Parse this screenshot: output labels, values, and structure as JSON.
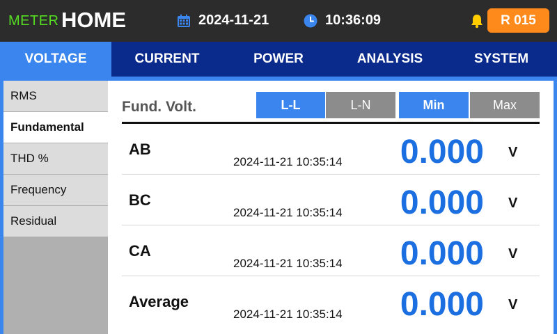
{
  "header": {
    "brand_prefix": "METER",
    "brand_title": "HOME",
    "date": "2024-11-21",
    "time": "10:36:09",
    "record_badge": "R 015"
  },
  "tabs": [
    {
      "label": "VOLTAGE",
      "active": true
    },
    {
      "label": "CURRENT",
      "active": false
    },
    {
      "label": "POWER",
      "active": false
    },
    {
      "label": "ANALYSIS",
      "active": false
    },
    {
      "label": "SYSTEM",
      "active": false
    }
  ],
  "sidebar": {
    "items": [
      {
        "label": "RMS",
        "active": false
      },
      {
        "label": "Fundamental",
        "active": true
      },
      {
        "label": "THD %",
        "active": false
      },
      {
        "label": "Frequency",
        "active": false
      },
      {
        "label": "Residual",
        "active": false
      }
    ]
  },
  "main": {
    "title": "Fund. Volt.",
    "connection_toggle": {
      "ll": "L-L",
      "ln": "L-N",
      "selected": "L-L"
    },
    "range_toggle": {
      "min": "Min",
      "max": "Max",
      "selected": "Min"
    },
    "rows": [
      {
        "label": "AB",
        "timestamp": "2024-11-21 10:35:14",
        "value": "0.000",
        "unit": "V"
      },
      {
        "label": "BC",
        "timestamp": "2024-11-21 10:35:14",
        "value": "0.000",
        "unit": "V"
      },
      {
        "label": "CA",
        "timestamp": "2024-11-21 10:35:14",
        "value": "0.000",
        "unit": "V"
      },
      {
        "label": "Average",
        "timestamp": "2024-11-21 10:35:14",
        "value": "0.000",
        "unit": "V"
      }
    ]
  },
  "colors": {
    "header_bg": "#2c2c2c",
    "brand_green": "#55dd22",
    "tab_bg": "#0a2a8c",
    "accent_blue": "#3a86ee",
    "value_blue": "#1c6fe0",
    "toggle_off": "#8c8c8c",
    "badge_orange": "#ff8a1c",
    "bell_yellow": "#ffcc00"
  },
  "icons": {
    "calendar": "calendar-icon",
    "clock": "clock-icon",
    "bell": "bell-icon"
  }
}
